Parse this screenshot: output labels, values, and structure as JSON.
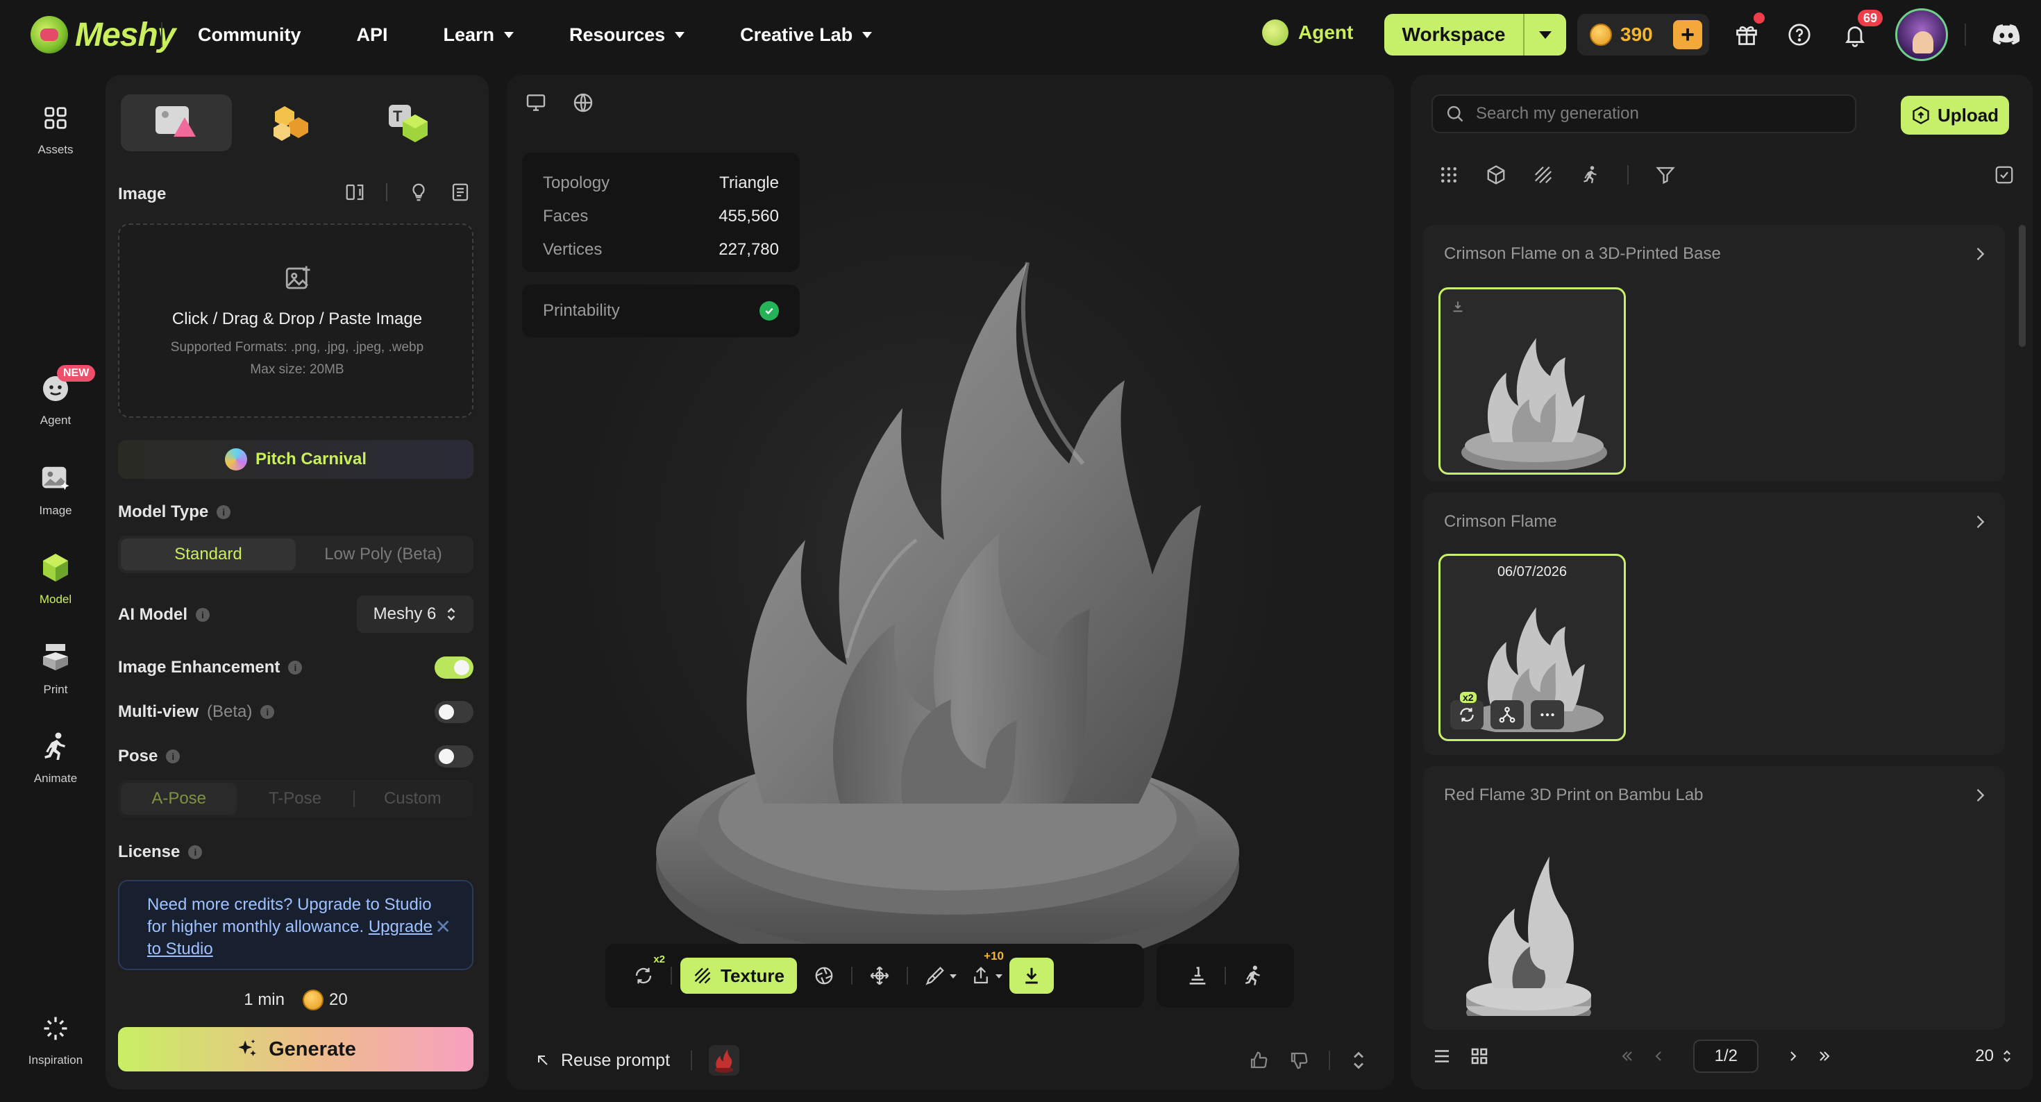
{
  "brand": {
    "name": "Meshy"
  },
  "nav": [
    {
      "label": "Community",
      "dropdown": false
    },
    {
      "label": "API",
      "dropdown": false
    },
    {
      "label": "Learn",
      "dropdown": true
    },
    {
      "label": "Resources",
      "dropdown": true
    },
    {
      "label": "Creative Lab",
      "dropdown": true
    }
  ],
  "header": {
    "agent_label": "Agent",
    "workspace_label": "Workspace",
    "credits": "390",
    "notification_count": "69"
  },
  "rail": {
    "assets": "Assets",
    "agent": "Agent",
    "agent_badge": "NEW",
    "image": "Image",
    "model": "Model",
    "print": "Print",
    "animate": "Animate",
    "inspiration": "Inspiration"
  },
  "panel": {
    "image_label": "Image",
    "upload_title": "Click / Drag & Drop / Paste Image",
    "upload_formats": "Supported Formats: .png, .jpg, .jpeg, .webp",
    "upload_max": "Max size: 20MB",
    "pitch_label": "Pitch Carnival",
    "model_type_label": "Model Type",
    "model_type_options": [
      "Standard",
      "Low Poly (Beta)"
    ],
    "ai_model_label": "AI Model",
    "ai_model_value": "Meshy 6",
    "image_enhancement_label": "Image Enhancement",
    "multiview_label": "Multi-view",
    "multiview_suffix": "(Beta)",
    "pose_label": "Pose",
    "pose_options": [
      "A-Pose",
      "T-Pose",
      "Custom"
    ],
    "license_label": "License",
    "upsell_text": "Need more credits? Upgrade to Studio for higher monthly allowance.",
    "upsell_link": "Upgrade to Studio",
    "time_estimate": "1 min",
    "cost": "20",
    "generate_label": "Generate",
    "toggles": {
      "image_enhancement": true,
      "multiview": false,
      "pose": false
    }
  },
  "viewport": {
    "stats": [
      {
        "key": "Topology",
        "value": "Triangle"
      },
      {
        "key": "Faces",
        "value": "455,560"
      },
      {
        "key": "Vertices",
        "value": "227,780"
      }
    ],
    "printability_label": "Printability",
    "texture_label": "Texture",
    "remesh_badge": "x2",
    "export_badge": "+10",
    "reuse_prompt_label": "Reuse prompt"
  },
  "right": {
    "search_placeholder": "Search my generation",
    "upload_label": "Upload",
    "generations": [
      {
        "title": "Crimson Flame on a 3D-Printed Base",
        "date": ""
      },
      {
        "title": "Crimson Flame",
        "date": "06/07/2026",
        "badge": "x2"
      },
      {
        "title": "Red Flame 3D Print on Bambu Lab",
        "date": ""
      }
    ],
    "page": "1/2",
    "page_size": "20"
  },
  "colors": {
    "accent": "#c6f06a",
    "background": "#161616",
    "panel": "#1f1f1f",
    "coin": "#f2b632",
    "alert": "#ef3e4a"
  }
}
